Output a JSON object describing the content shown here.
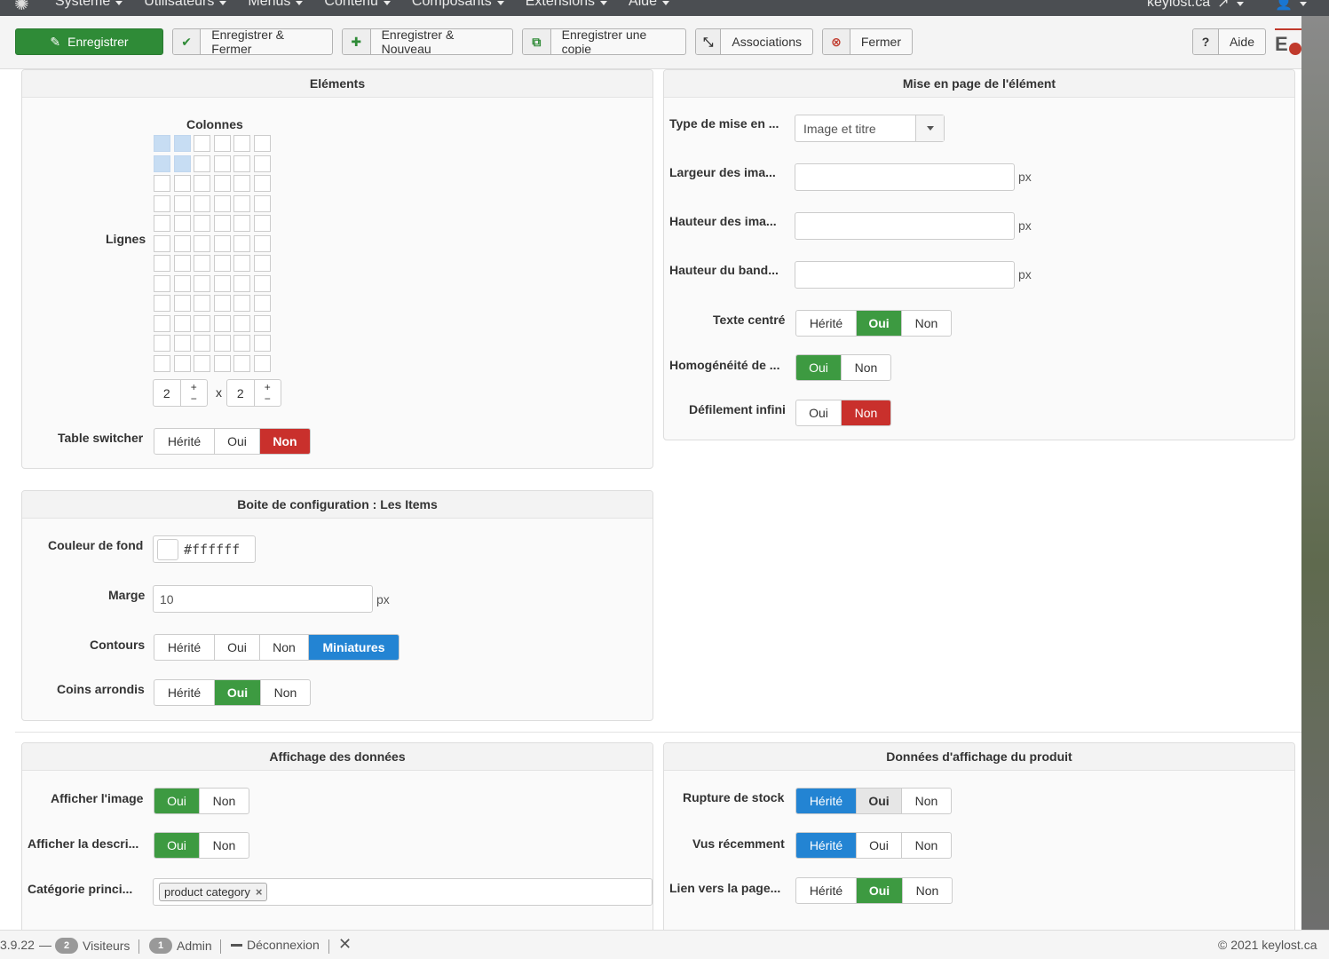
{
  "navbar": {
    "logo_icon": "joomla-logo-icon",
    "menus": [
      "Système",
      "Utilisateurs",
      "Menus",
      "Contenu",
      "Composants",
      "Extensions",
      "Aide"
    ],
    "site": "keylost.ca",
    "user_icon": "user-icon"
  },
  "toolbar": {
    "save": "Enregistrer",
    "save_close": "Enregistrer & Fermer",
    "save_new": "Enregistrer & Nouveau",
    "save_copy": "Enregistrer une copie",
    "associations": "Associations",
    "close": "Fermer",
    "help": "Aide"
  },
  "elements_panel": {
    "title": "Eléments",
    "columns_label": "Colonnes",
    "rows_label": "Lignes",
    "grid": {
      "cols": 6,
      "rows": 12,
      "selected_cols": 2,
      "selected_rows": 2
    },
    "rows_value": "2",
    "cols_value": "2",
    "times": "x",
    "plus": "+",
    "minus": "−",
    "table_switcher": {
      "label": "Table switcher",
      "options": [
        "Hérité",
        "Oui",
        "Non"
      ],
      "selected": "Non"
    }
  },
  "layout_panel": {
    "title": "Mise en page de l'élément",
    "layout_type": {
      "label": "Type de mise en ...",
      "value": "Image et titre"
    },
    "image_width": {
      "label": "Largeur des ima...",
      "value": "",
      "unit": "px"
    },
    "image_height": {
      "label": "Hauteur des ima...",
      "value": "",
      "unit": "px"
    },
    "band_height": {
      "label": "Hauteur du band...",
      "value": "",
      "unit": "px"
    },
    "centered_text": {
      "label": "Texte centré",
      "options": [
        "Hérité",
        "Oui",
        "Non"
      ],
      "selected": "Oui"
    },
    "homogeneity": {
      "label": "Homogénéité de ...",
      "options": [
        "Oui",
        "Non"
      ],
      "selected": "Oui"
    },
    "infinite_scroll": {
      "label": "Défilement infini",
      "options": [
        "Oui",
        "Non"
      ],
      "selected": "Non"
    }
  },
  "items_panel": {
    "title": "Boite de configuration : Les Items",
    "bg_color": {
      "label": "Couleur de fond",
      "value": "#ffffff"
    },
    "margin": {
      "label": "Marge",
      "value": "10",
      "unit": "px"
    },
    "borders": {
      "label": "Contours",
      "options": [
        "Hérité",
        "Oui",
        "Non",
        "Miniatures"
      ],
      "selected": "Miniatures"
    },
    "rounded": {
      "label": "Coins arrondis",
      "options": [
        "Hérité",
        "Oui",
        "Non"
      ],
      "selected": "Oui"
    }
  },
  "display_panel": {
    "title": "Affichage des données",
    "show_image": {
      "label": "Afficher l'image",
      "options": [
        "Oui",
        "Non"
      ],
      "selected": "Oui"
    },
    "show_desc": {
      "label": "Afficher la descri...",
      "options": [
        "Oui",
        "Non"
      ],
      "selected": "Oui"
    },
    "main_category": {
      "label": "Catégorie princi...",
      "tag": "product category",
      "remove": "×"
    }
  },
  "product_panel": {
    "title": "Données d'affichage du produit",
    "out_of_stock": {
      "label": "Rupture de stock",
      "options": [
        "Hérité",
        "Oui",
        "Non"
      ],
      "selected": "Hérité"
    },
    "recently_viewed": {
      "label": "Vus récemment",
      "options": [
        "Hérité",
        "Oui",
        "Non"
      ],
      "selected": "Hérité"
    },
    "link_page": {
      "label": "Lien vers la page...",
      "options": [
        "Hérité",
        "Oui",
        "Non"
      ],
      "selected": "Oui"
    }
  },
  "statusbar": {
    "version": "3.9.22",
    "dash": "—",
    "visitors_count": "2",
    "visitors": "Visiteurs",
    "admin_count": "1",
    "admin": "Admin",
    "logout": "Déconnexion",
    "copyright": "© 2021 keylost.ca"
  },
  "colors": {
    "green": "#3d9a41",
    "red": "#c9302c",
    "blue": "#2384d3",
    "save_green": "#2f8b37"
  }
}
